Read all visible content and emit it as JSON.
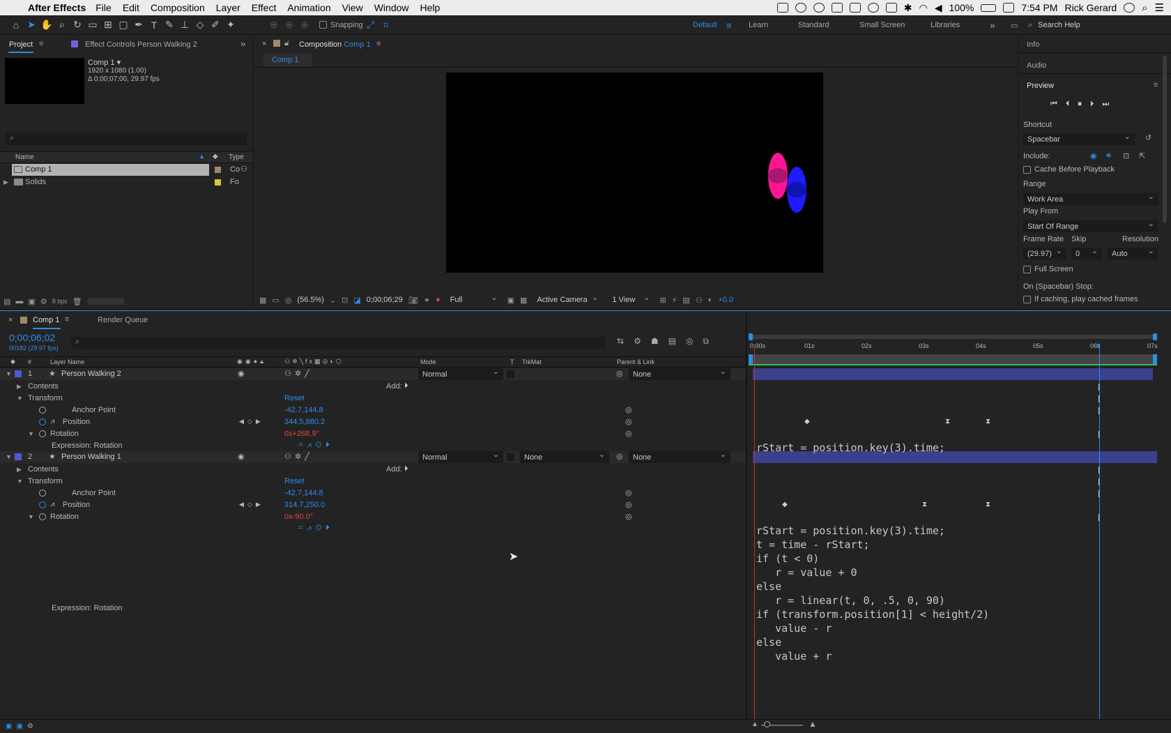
{
  "menubar": {
    "app": "After Effects",
    "items": [
      "File",
      "Edit",
      "Composition",
      "Layer",
      "Effect",
      "Animation",
      "View",
      "Window",
      "Help"
    ],
    "battery": "100%",
    "time": "7:54 PM",
    "user": "Rick Gerard"
  },
  "toolbar": {
    "snapping": "Snapping",
    "workspaces": [
      "Default",
      "Learn",
      "Standard",
      "Small Screen",
      "Libraries"
    ],
    "active_workspace": "Default",
    "search_placeholder": "Search Help"
  },
  "project": {
    "tab_project": "Project",
    "tab_effects": "Effect Controls Person Walking 2",
    "comp_name": "Comp 1 ▾",
    "comp_res": "1920 x 1080 (1.00)",
    "comp_dur": "Δ 0;00;07;00, 29.97 fps",
    "col_name": "Name",
    "col_type": "Type",
    "items": [
      {
        "name": "Comp 1",
        "type": "Co",
        "color": "#a08a6a"
      },
      {
        "name": "Solids",
        "type": "Fo",
        "color": "#d8c830"
      }
    ],
    "bpc": "8 bpc"
  },
  "composition": {
    "tab_label": "Composition",
    "tab_comp": "Comp 1",
    "subtab": "Comp 1",
    "zoom": "(56.5%)",
    "timecode": "0;00;06;29",
    "resolution": "Full",
    "camera": "Active Camera",
    "views": "1 View",
    "exposure": "+0.0"
  },
  "right_panel": {
    "info": "Info",
    "audio": "Audio",
    "preview": "Preview",
    "shortcut_label": "Shortcut",
    "shortcut_value": "Spacebar",
    "include_label": "Include:",
    "cache_before": "Cache Before Playback",
    "range_label": "Range",
    "range_value": "Work Area",
    "play_from_label": "Play From",
    "play_from_value": "Start Of Range",
    "frame_rate_label": "Frame Rate",
    "skip_label": "Skip",
    "resolution_label": "Resolution",
    "frame_rate_value": "(29.97)",
    "skip_value": "0",
    "resolution_value": "Auto",
    "full_screen": "Full Screen",
    "on_stop": "On (Spacebar) Stop:",
    "if_caching": "If caching, play cached frames"
  },
  "timeline": {
    "tab": "Comp 1",
    "render_queue": "Render Queue",
    "timecode": "0;00;06;02",
    "frame_info": "00182 (29.97 fps)",
    "col_layer_name": "Layer Name",
    "col_mode": "Mode",
    "col_t": "T",
    "col_trkmat": "TrkMat",
    "col_parent": "Parent & Link",
    "ruler": [
      "0:00s",
      "01s",
      "02s",
      "03s",
      "04s",
      "05s",
      "06s",
      "07s"
    ],
    "layers": [
      {
        "num": "1",
        "name": "Person Walking 2",
        "mode": "Normal",
        "trkmat": "",
        "parent": "None",
        "contents": "Contents",
        "add": "Add:",
        "transform": "Transform",
        "reset": "Reset",
        "anchor_label": "Anchor Point",
        "anchor": "-42.7,144.8",
        "position_label": "Position",
        "position": "344.5,880.2",
        "rotation_label": "Rotation",
        "rotation_prefix": "0x",
        "rotation": "+268.9°",
        "expr_label": "Expression: Rotation",
        "expr_preview": "rStart = position.key(3).time;"
      },
      {
        "num": "2",
        "name": "Person Walking 1",
        "mode": "Normal",
        "trkmat": "None",
        "parent": "None",
        "contents": "Contents",
        "add": "Add:",
        "transform": "Transform",
        "reset": "Reset",
        "anchor_label": "Anchor Point",
        "anchor": "-42.7,144.8",
        "position_label": "Position",
        "position": "314.7,250.0",
        "rotation_label": "Rotation",
        "rotation_prefix": "0x",
        "rotation": "-90.0°",
        "expr_label": "Expression: Rotation"
      }
    ],
    "expression_code": "rStart = position.key(3).time;\nt = time - rStart;\nif (t < 0)\n   r = value + 0\nelse\n   r = linear(t, 0, .5, 0, 90)\nif (transform.position[1] < height/2)\n   value - r\nelse\n   value + r"
  },
  "colors": {
    "accent": "#2d8ceb",
    "pink_ellipse": "#ff1493",
    "blue_ellipse": "#1c1cff",
    "rotation_red": "#e0443e",
    "layer_label": "#4a5bd6"
  }
}
